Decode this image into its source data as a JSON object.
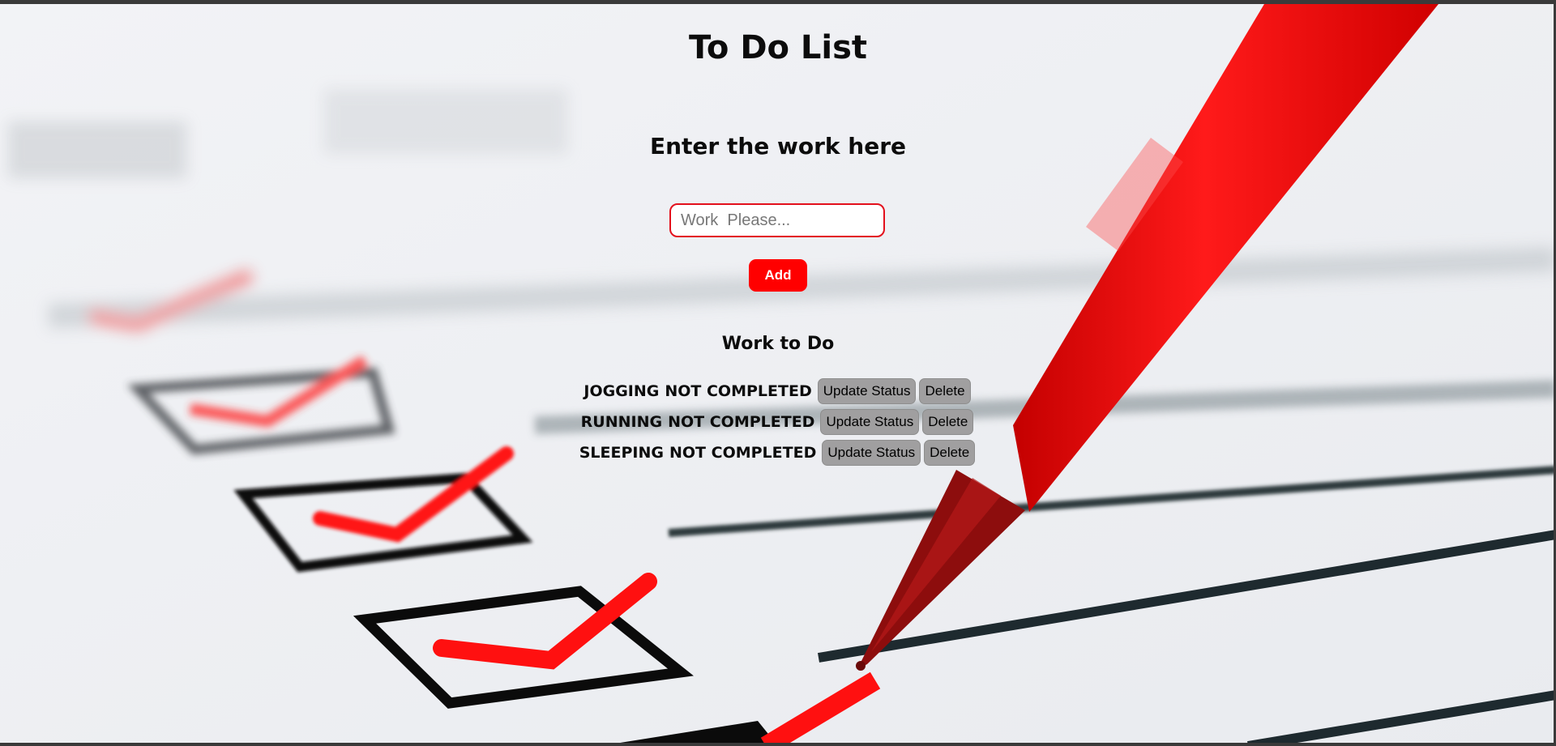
{
  "app": {
    "title": "To Do List",
    "subtitle": "Enter the work here"
  },
  "form": {
    "input_value": "",
    "input_placeholder": "Work  Please...",
    "add_label": "Add"
  },
  "list": {
    "heading": "Work to Do",
    "items": [
      {
        "name": "JOGGING",
        "status": "NOT COMPLETED",
        "update_label": "Update Status",
        "delete_label": "Delete"
      },
      {
        "name": "RUNNING",
        "status": "NOT COMPLETED",
        "update_label": "Update Status",
        "delete_label": "Delete"
      },
      {
        "name": "SLEEPING",
        "status": "NOT COMPLETED",
        "update_label": "Update Status",
        "delete_label": "Delete"
      }
    ]
  },
  "colors": {
    "accent": "#ff0000",
    "input_border": "#e3101c",
    "button_gray": "#a09fa0",
    "background": "#eef0f3"
  }
}
